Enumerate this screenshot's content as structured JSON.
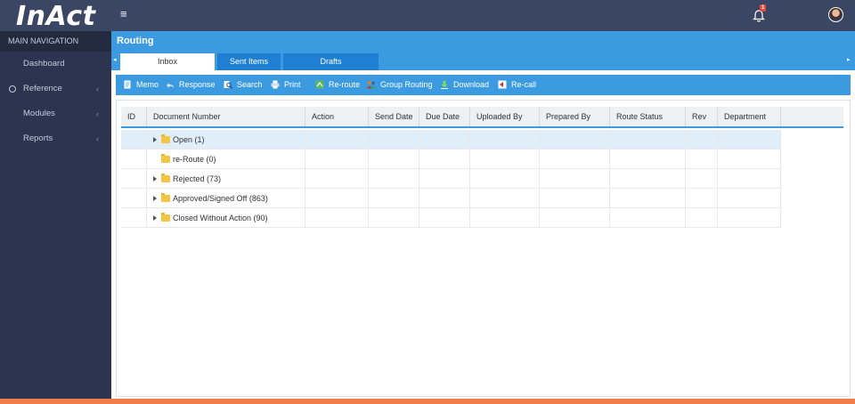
{
  "app": {
    "logo_text": "InAct",
    "notification_count": "1",
    "accent_color": "#3c9be0",
    "sidebar_color": "#2c3450",
    "footer_color": "#f07e4a"
  },
  "sidebar": {
    "header": "MAIN NAVIGATION",
    "items": [
      {
        "label": "Dashboard",
        "icon": "none",
        "has_caret": false
      },
      {
        "label": "Reference",
        "icon": "circle-icon",
        "has_caret": true
      },
      {
        "label": "Modules",
        "icon": "none",
        "has_caret": true
      },
      {
        "label": "Reports",
        "icon": "none",
        "has_caret": true
      }
    ],
    "caret": "‹"
  },
  "main": {
    "title": "Routing",
    "tabs": [
      {
        "label": "Inbox",
        "active": true
      },
      {
        "label": "Sent Items",
        "active": false
      },
      {
        "label": "Drafts",
        "active": false
      }
    ],
    "toolbar": [
      {
        "label": "Memo",
        "icon": "memo-icon"
      },
      {
        "label": "Response",
        "icon": "response-icon"
      },
      {
        "label": "Search",
        "icon": "search-icon"
      },
      {
        "label": "Print",
        "icon": "print-icon"
      },
      {
        "label": "Re-route",
        "icon": "reroute-icon"
      },
      {
        "label": "Group Routing",
        "icon": "group-routing-icon"
      },
      {
        "label": "Download",
        "icon": "download-icon"
      },
      {
        "label": "Re-call",
        "icon": "recall-icon"
      }
    ],
    "grid": {
      "columns": [
        "ID",
        "Document Number",
        "Action",
        "Send Date",
        "Due Date",
        "Uploaded By",
        "Prepared By",
        "Route Status",
        "Rev",
        "Department"
      ],
      "rows": [
        {
          "label": "Open (1)",
          "expandable": true,
          "selected": true
        },
        {
          "label": "re-Route (0)",
          "expandable": false,
          "selected": false
        },
        {
          "label": "Rejected (73)",
          "expandable": true,
          "selected": false
        },
        {
          "label": "Approved/Signed Off (863)",
          "expandable": true,
          "selected": false
        },
        {
          "label": "Closed Without Action (90)",
          "expandable": true,
          "selected": false
        }
      ]
    }
  }
}
